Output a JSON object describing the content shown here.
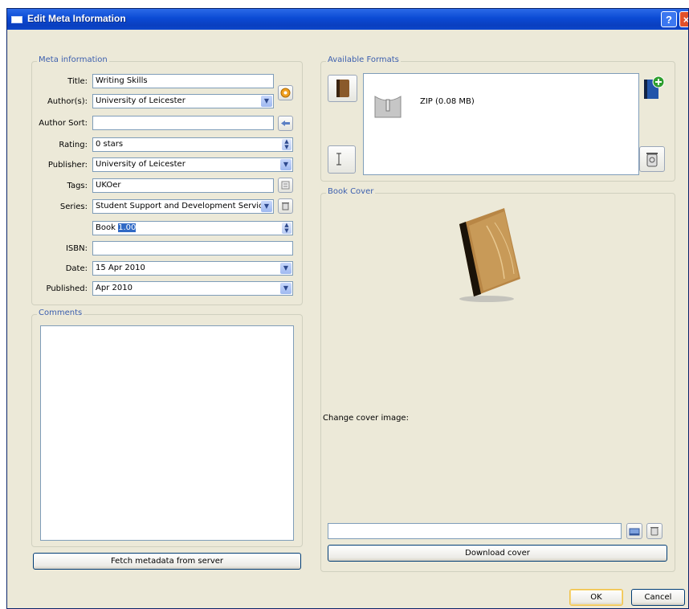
{
  "window": {
    "title": "Edit Meta Information",
    "help_glyph": "?",
    "close_glyph": "×"
  },
  "meta": {
    "group_label": "Meta information",
    "title_label": "Title:",
    "title_value": "Writing Skills",
    "authors_label": "Author(s):",
    "authors_value": "University of Leicester",
    "author_sort_label": "Author Sort:",
    "author_sort_value": "",
    "rating_label": "Rating:",
    "rating_value": "0 stars",
    "publisher_label": "Publisher:",
    "publisher_value": "University of Leicester",
    "tags_label": "Tags:",
    "tags_value": "UKOer",
    "series_label": "Series:",
    "series_value": "Student Support and Development Services",
    "series_index_prefix": "Book ",
    "series_index_value": "1.00",
    "isbn_label": "ISBN:",
    "isbn_value": "",
    "date_label": "Date:",
    "date_value": "15 Apr 2010",
    "published_label": "Published:",
    "published_value": "Apr 2010"
  },
  "comments": {
    "group_label": "Comments",
    "value": ""
  },
  "fetch_button": "Fetch metadata from server",
  "formats": {
    "group_label": "Available Formats",
    "items": [
      {
        "label": "ZIP (0.08 MB)"
      }
    ]
  },
  "cover": {
    "group_label": "Book Cover",
    "change_label": "Change cover image:",
    "path_value": "",
    "download_button": "Download cover"
  },
  "dialog_buttons": {
    "ok": "OK",
    "cancel": "Cancel"
  },
  "colors": {
    "titlebar": "#0b4ad4",
    "group_label": "#3c5fae",
    "dialog_bg": "#ece9d8"
  }
}
